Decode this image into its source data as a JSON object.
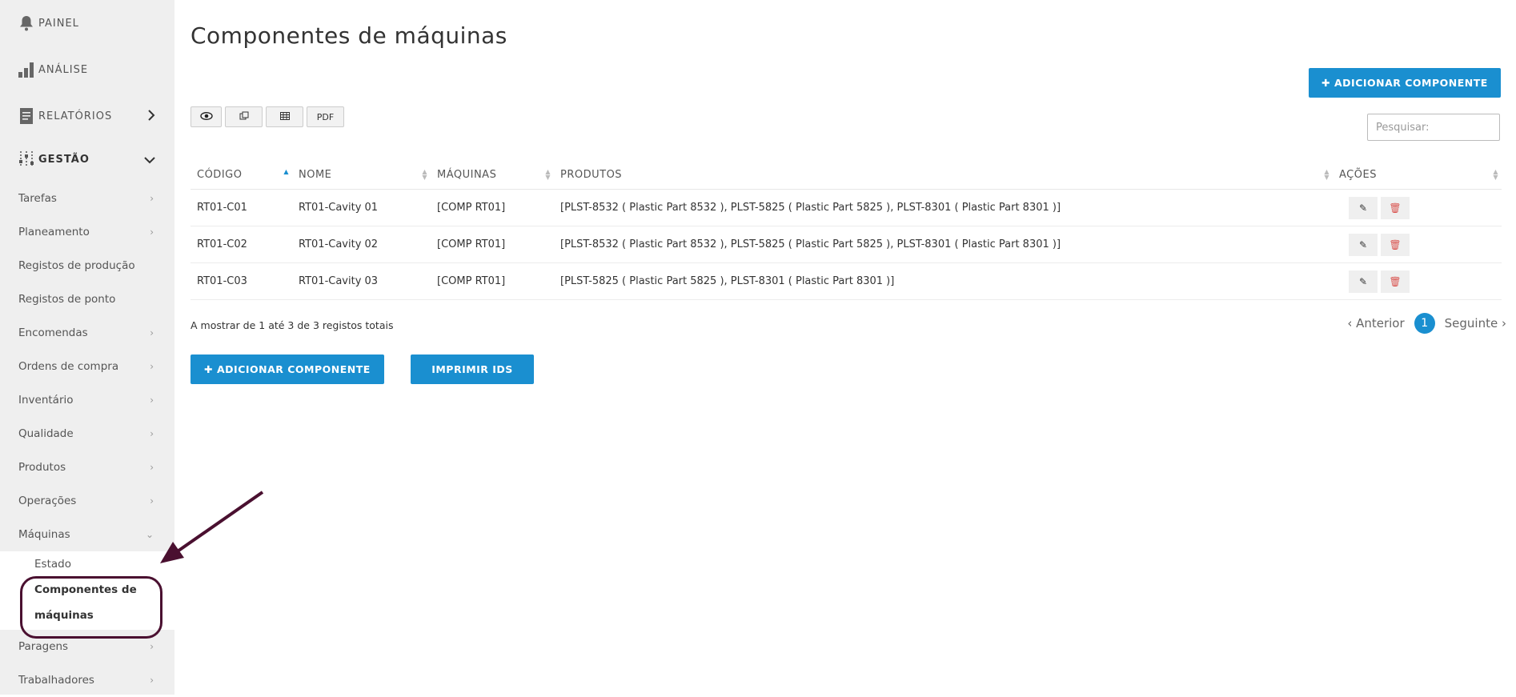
{
  "sidebar": {
    "top": [
      {
        "label": "PAINEL",
        "icon": "bell-icon"
      },
      {
        "label": "ANÁLISE",
        "icon": "bar-chart-icon"
      },
      {
        "label": "RELATÓRIOS",
        "icon": "document-icon"
      },
      {
        "label": "GESTÃO",
        "icon": "sliders-icon"
      }
    ],
    "items": [
      {
        "label": "Tarefas"
      },
      {
        "label": "Planeamento"
      },
      {
        "label": "Registos de produção"
      },
      {
        "label": "Registos de ponto"
      },
      {
        "label": "Encomendas"
      },
      {
        "label": "Ordens de compra"
      },
      {
        "label": "Inventário"
      },
      {
        "label": "Qualidade"
      },
      {
        "label": "Produtos"
      },
      {
        "label": "Operações"
      },
      {
        "label": "Máquinas"
      }
    ],
    "machines_sub": [
      {
        "label": "Estado"
      },
      {
        "label_line1": "Componentes de",
        "label_line2": "máquinas"
      }
    ],
    "after": [
      {
        "label": "Paragens"
      },
      {
        "label": "Trabalhadores"
      }
    ]
  },
  "main": {
    "title": "Componentes de máquinas",
    "add_button": "✚ ADICIONAR COMPONENTE",
    "print_button": "IMPRIMIR IDS",
    "toolbar": {
      "pdf": "PDF"
    },
    "search_placeholder": "Pesquisar:",
    "table": {
      "headers": [
        "CÓDIGO",
        "NOME",
        "MÁQUINAS",
        "PRODUTOS",
        "AÇÕES"
      ],
      "rows": [
        {
          "code": "RT01-C01",
          "name": "RT01-Cavity 01",
          "machines": "[COMP RT01]",
          "products": "[PLST-8532 ( Plastic Part 8532 ), PLST-5825 ( Plastic Part 5825 ), PLST-8301 ( Plastic Part 8301 )]"
        },
        {
          "code": "RT01-C02",
          "name": "RT01-Cavity 02",
          "machines": "[COMP RT01]",
          "products": "[PLST-8532 ( Plastic Part 8532 ), PLST-5825 ( Plastic Part 5825 ), PLST-8301 ( Plastic Part 8301 )]"
        },
        {
          "code": "RT01-C03",
          "name": "RT01-Cavity 03",
          "machines": "[COMP RT01]",
          "products": "[PLST-5825 ( Plastic Part 5825 ), PLST-8301 ( Plastic Part 8301 )]"
        }
      ]
    },
    "info": "A mostrar de 1 até 3 de 3 registos totais",
    "pagination": {
      "prev": "‹ Anterior",
      "current": "1",
      "next": "Seguinte ›"
    }
  },
  "colors": {
    "accent": "#1a8fd0",
    "annotation": "#4a1030",
    "sidebar_bg": "#efefef"
  }
}
